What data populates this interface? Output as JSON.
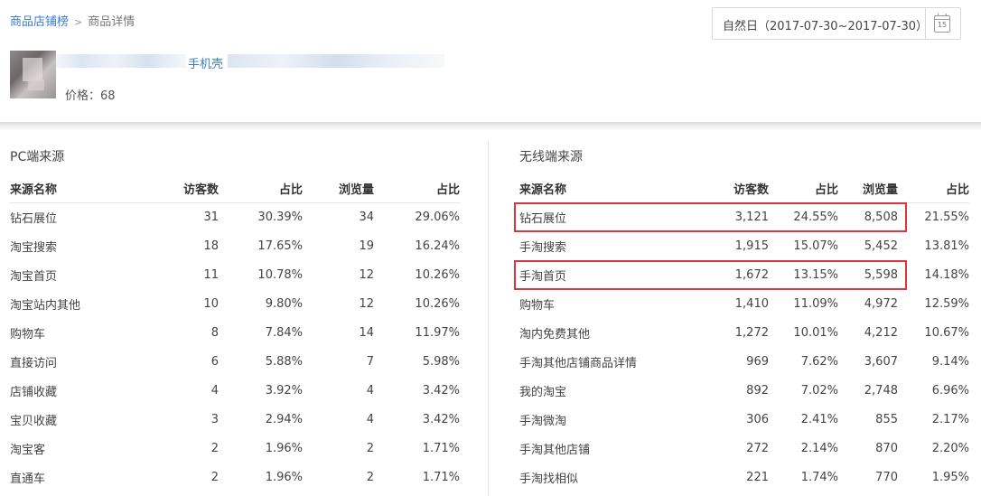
{
  "breadcrumb": {
    "root": "商品店铺榜",
    "separator": ">",
    "current": "商品详情"
  },
  "date_range": {
    "label": "自然日（2017-07-30~2017-07-30）",
    "calendar_icon": "calendar-icon",
    "calendar_day": "15"
  },
  "product": {
    "title": "手机壳",
    "price": "价格：68"
  },
  "pc_source": {
    "title": "PC端来源",
    "columns": [
      "来源名称",
      "访客数",
      "占比",
      "浏览量",
      "占比"
    ],
    "rows": [
      [
        "钻石展位",
        "31",
        "30.39%",
        "34",
        "29.06%"
      ],
      [
        "淘宝搜索",
        "18",
        "17.65%",
        "19",
        "16.24%"
      ],
      [
        "淘宝首页",
        "11",
        "10.78%",
        "12",
        "10.26%"
      ],
      [
        "淘宝站内其他",
        "10",
        "9.80%",
        "12",
        "10.26%"
      ],
      [
        "购物车",
        "8",
        "7.84%",
        "14",
        "11.97%"
      ],
      [
        "直接访问",
        "6",
        "5.88%",
        "7",
        "5.98%"
      ],
      [
        "店铺收藏",
        "4",
        "3.92%",
        "4",
        "3.42%"
      ],
      [
        "宝贝收藏",
        "3",
        "2.94%",
        "4",
        "3.42%"
      ],
      [
        "淘宝客",
        "2",
        "1.96%",
        "2",
        "1.71%"
      ],
      [
        "直通车",
        "2",
        "1.96%",
        "2",
        "1.71%"
      ]
    ]
  },
  "mobile_source": {
    "title": "无线端来源",
    "columns": [
      "来源名称",
      "访客数",
      "占比",
      "浏览量",
      "占比"
    ],
    "rows": [
      [
        "钻石展位",
        "3,121",
        "24.55%",
        "8,508",
        "21.55%"
      ],
      [
        "手淘搜索",
        "1,915",
        "15.07%",
        "5,452",
        "13.81%"
      ],
      [
        "手淘首页",
        "1,672",
        "13.15%",
        "5,598",
        "14.18%"
      ],
      [
        "购物车",
        "1,410",
        "11.09%",
        "4,972",
        "12.59%"
      ],
      [
        "淘内免费其他",
        "1,272",
        "10.01%",
        "4,212",
        "10.67%"
      ],
      [
        "手淘其他店铺商品详情",
        "969",
        "7.62%",
        "3,607",
        "9.14%"
      ],
      [
        "我的淘宝",
        "892",
        "7.02%",
        "2,748",
        "6.96%"
      ],
      [
        "手淘微淘",
        "306",
        "2.41%",
        "855",
        "2.17%"
      ],
      [
        "手淘其他店铺",
        "272",
        "2.14%",
        "870",
        "2.20%"
      ],
      [
        "手淘找相似",
        "221",
        "1.74%",
        "770",
        "1.95%"
      ]
    ]
  },
  "colors": {
    "link": "#3a7bd5",
    "highlight": "#d9363e"
  }
}
